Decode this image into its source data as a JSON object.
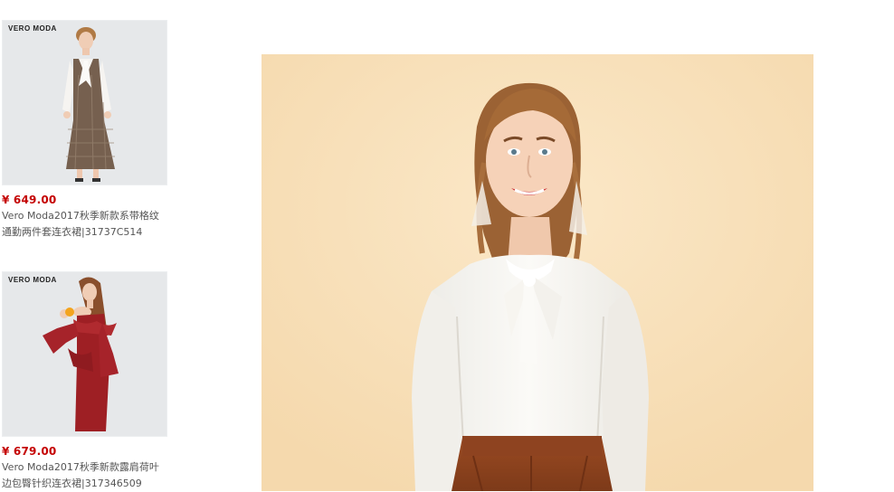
{
  "sidebar": {
    "products": [
      {
        "brand": "VERO MODA",
        "price": "¥ 649.00",
        "title": "Vero Moda2017秋季新款系带格纹通勤两件套连衣裙|31737C514"
      },
      {
        "brand": "VERO MODA",
        "price": "¥ 679.00",
        "title": "Vero Moda2017秋季新款露肩荷叶边包臀针织连衣裙|317346509"
      }
    ]
  },
  "colors": {
    "price": "#c40000",
    "hero_background": "#f7dfb6",
    "thumb_background": "#e6e8ea"
  }
}
